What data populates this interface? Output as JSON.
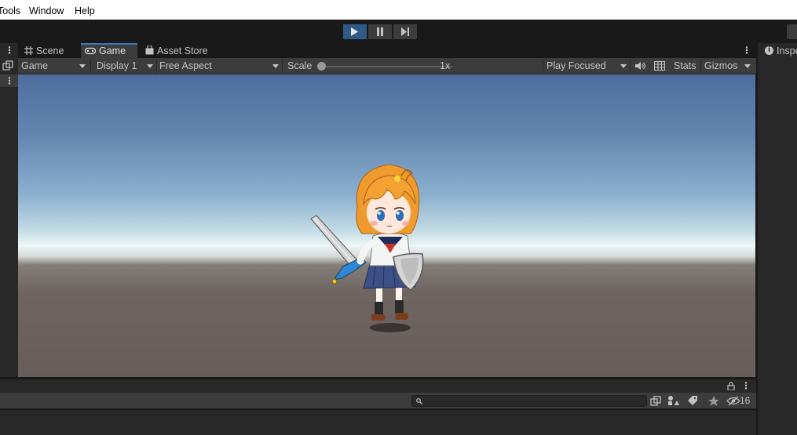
{
  "menu": {
    "items": [
      "Tools",
      "Window",
      "Help"
    ]
  },
  "playbar": {
    "play_icon": "play-icon",
    "pause_icon": "pause-icon",
    "step_icon": "step-icon",
    "accent": "#2e5a85"
  },
  "tabs": [
    {
      "label": "Scene",
      "icon": "grid-icon"
    },
    {
      "label": "Game",
      "icon": "gamepad-icon"
    },
    {
      "label": "Asset Store",
      "icon": "bag-icon"
    }
  ],
  "game_toolbar": {
    "mode": "Game",
    "display": "Display 1",
    "aspect": "Free Aspect",
    "scale_label": "Scale",
    "scale_value": "1x",
    "play_mode": "Play Focused",
    "stats": "Stats",
    "gizmos": "Gizmos"
  },
  "inspector": {
    "title": "Inspe",
    "icon": "info-icon"
  },
  "console": {
    "search_placeholder": "",
    "count": "16"
  },
  "colors": {
    "tab_accent": "#3a79bb",
    "panel": "#3c3c3c",
    "dark": "#191919"
  }
}
